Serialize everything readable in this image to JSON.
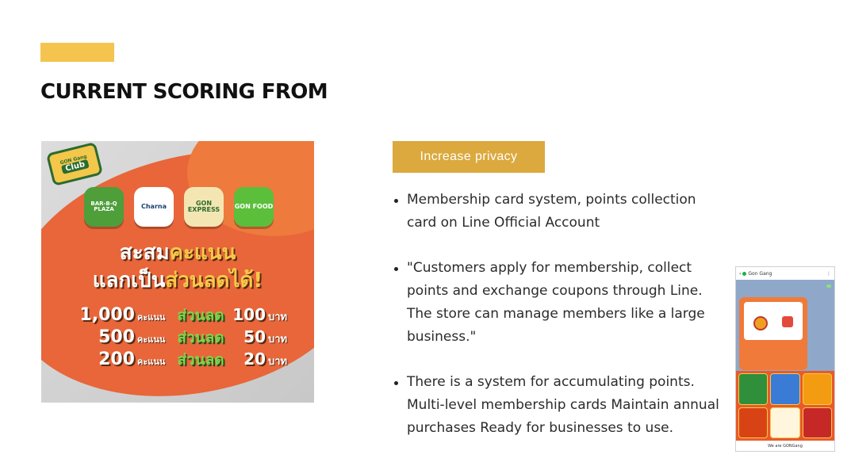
{
  "section": {
    "title": "CURRENT SCORING FROM",
    "accent_color": "#f4c44f"
  },
  "poster": {
    "club_badge": {
      "small": "GON Gang",
      "label": "Club"
    },
    "brands": [
      "BAR-B-Q PLAZA",
      "Charna",
      "GON EXPRESS",
      "GON FOOD"
    ],
    "headline_line1_a": "สะสม",
    "headline_line1_b": "คะแนน",
    "headline_line2_a": "แลกเป็น",
    "headline_line2_b": "ส่วนลดได้!",
    "rows": [
      {
        "points": "1,000",
        "points_unit": "คะแนน",
        "discount": "ส่วนลด",
        "amount": "100",
        "currency": "บาท"
      },
      {
        "points": "500",
        "points_unit": "คะแนน",
        "discount": "ส่วนลด",
        "amount": "50",
        "currency": "บาท"
      },
      {
        "points": "200",
        "points_unit": "คะแนน",
        "discount": "ส่วนลด",
        "amount": "20",
        "currency": "บาท"
      }
    ]
  },
  "privacy_tag": {
    "label": "Increase privacy",
    "color": "#dba93d"
  },
  "bullets": [
    "Membership card system, points collection card on Line Official Account",
    "\"Customers apply for membership, collect points and exchange coupons through Line. The store can manage members like a large business.\"",
    "There is a system for accumulating points. Multi-level membership cards Maintain annual purchases Ready for businesses to use."
  ],
  "phone": {
    "chat_name": "Gon Gang",
    "footer": "We are GONGang"
  }
}
